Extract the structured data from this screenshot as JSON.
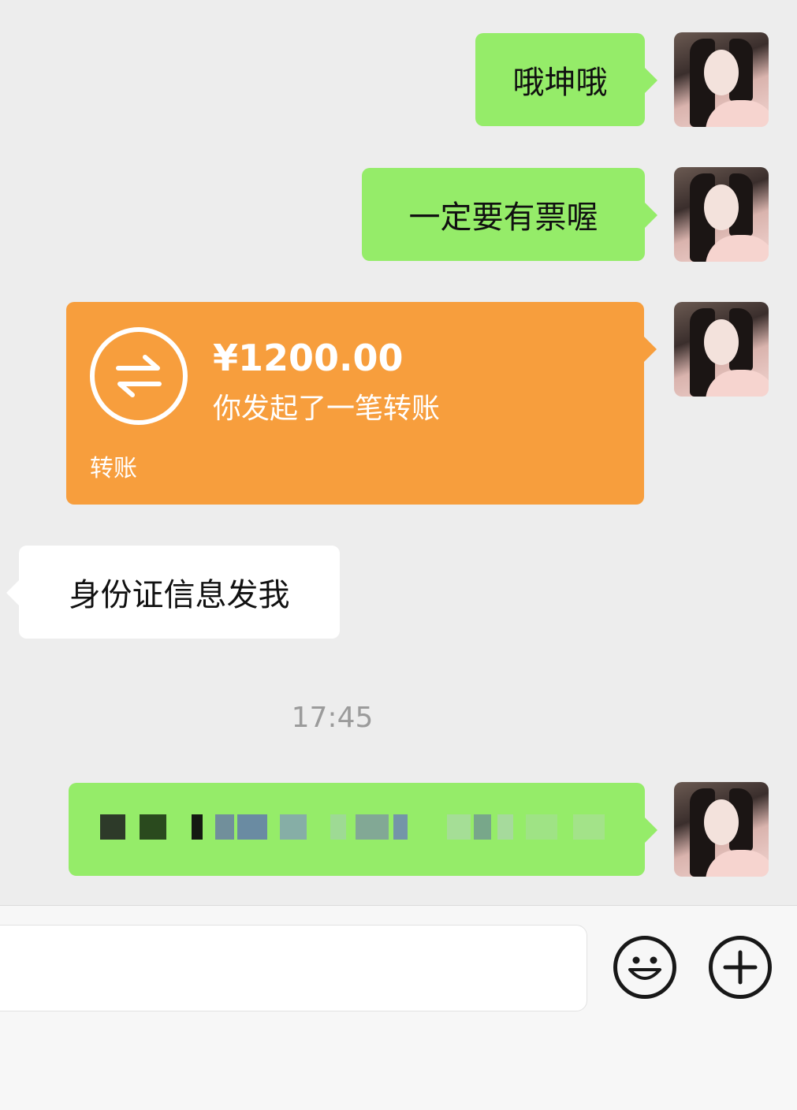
{
  "messages": [
    {
      "id": "m1",
      "side": "right",
      "text": "哦坤哦"
    },
    {
      "id": "m2",
      "side": "right",
      "text": "一定要有票喔"
    },
    {
      "id": "m3",
      "side": "right",
      "type": "transfer",
      "amount": "¥1200.00",
      "description": "你发起了一笔转账",
      "label": "转账"
    },
    {
      "id": "m4",
      "side": "left",
      "text": "身份证信息发我"
    },
    {
      "id": "m5",
      "side": "right",
      "type": "redacted"
    }
  ],
  "timestamp": "17:45",
  "colors": {
    "background": "#ededed",
    "sent_bubble": "#95ec69",
    "received_bubble": "#ffffff",
    "transfer_bubble": "#f79e3d"
  },
  "icons": {
    "emoji": "smiley-face-icon",
    "more": "plus-circle-icon",
    "transfer": "transfer-arrows-icon"
  }
}
